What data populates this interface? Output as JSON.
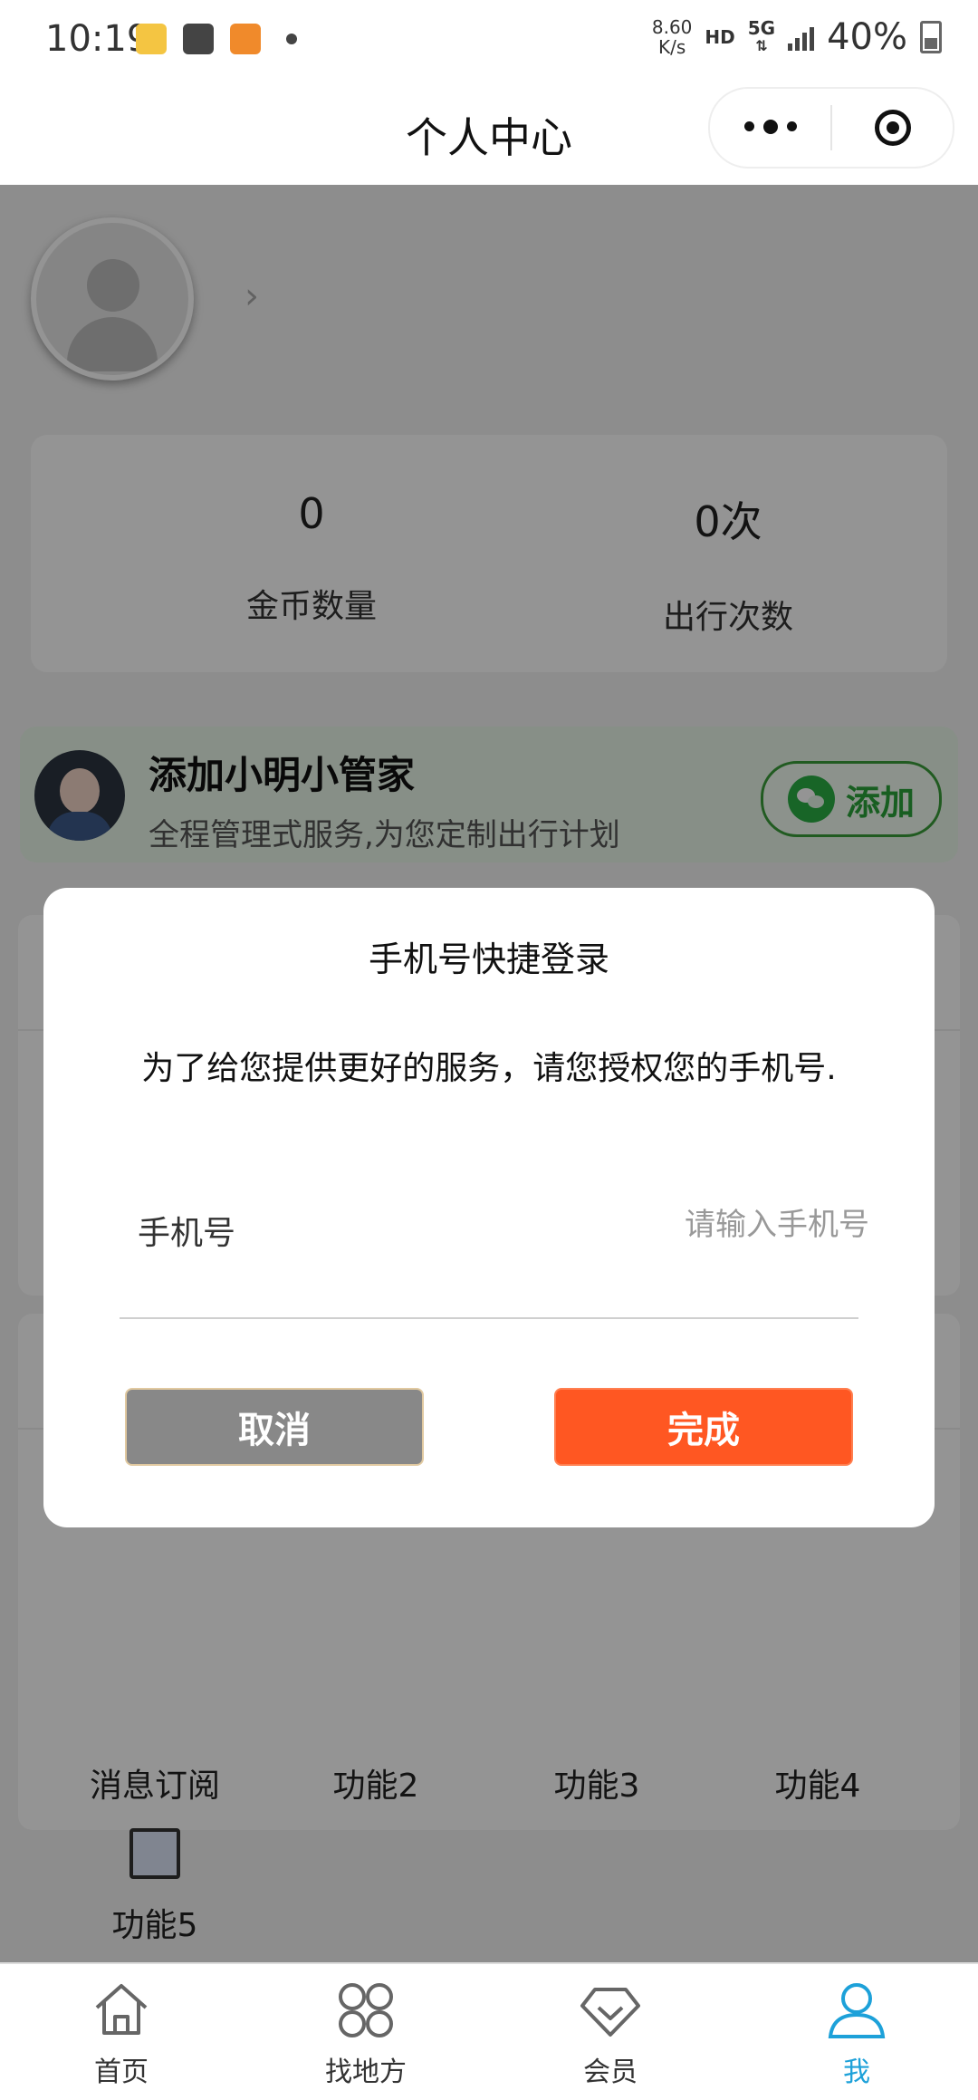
{
  "status_bar": {
    "time": "10:19",
    "speed_value": "8.60",
    "speed_unit": "K/s",
    "hd": "HD",
    "network": "5G",
    "battery": "40%"
  },
  "title_bar": {
    "title": "个人中心"
  },
  "profile": {
    "chevron": "›"
  },
  "stats": {
    "coins_value": "0",
    "coins_label": "金币数量",
    "trips_value": "0次",
    "trips_label": "出行次数"
  },
  "helper": {
    "title": "添加小明小管家",
    "subtitle": "全程管理式服务,为您定制出行计划",
    "add_label": "添加"
  },
  "functions": [
    {
      "label": "消息订阅",
      "icon": "message-subscribe-icon"
    },
    {
      "label": "功能2",
      "icon": "function-icon"
    },
    {
      "label": "功能3",
      "icon": "function-icon"
    },
    {
      "label": "功能4",
      "icon": "function-icon"
    },
    {
      "label": "功能5",
      "icon": "map-icon"
    }
  ],
  "modal": {
    "title": "手机号快捷登录",
    "message": "为了给您提供更好的服务，请您授权您的手机号.",
    "phone_label": "手机号",
    "phone_placeholder": "请输入手机号",
    "phone_value": "",
    "cancel_label": "取消",
    "done_label": "完成"
  },
  "tabbar": {
    "items": [
      {
        "label": "首页",
        "icon": "home-icon"
      },
      {
        "label": "找地方",
        "icon": "grid-icon"
      },
      {
        "label": "会员",
        "icon": "diamond-icon"
      },
      {
        "label": "我",
        "icon": "user-icon",
        "active": true
      }
    ]
  },
  "colors": {
    "accent_orange": "#ff5722",
    "cancel_gray": "#888888",
    "wechat_green": "#2aae44",
    "tab_active": "#1da1d9"
  }
}
